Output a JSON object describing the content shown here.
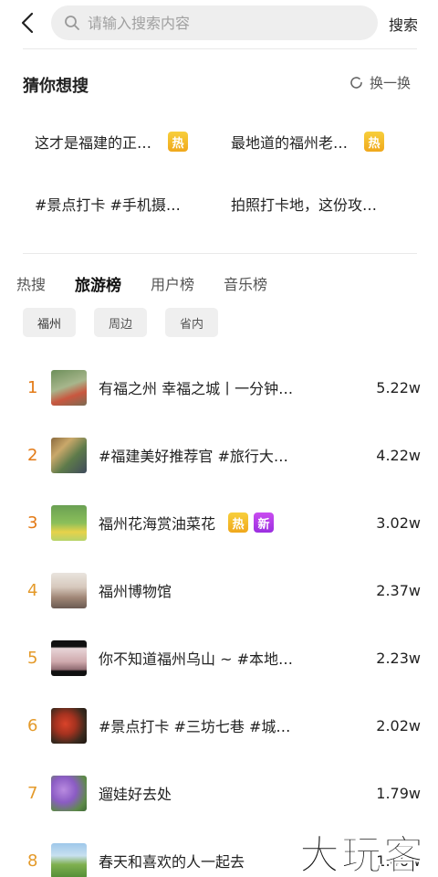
{
  "header": {
    "search_placeholder": "请输入搜索内容",
    "search_button": "搜索"
  },
  "guess": {
    "title": "猜你想搜",
    "refresh_label": "换一换",
    "items": [
      {
        "text": "这才是福建的正…",
        "badge": "热"
      },
      {
        "text": "最地道的福州老…",
        "badge": "热"
      },
      {
        "text": "#景点打卡 #手机摄…",
        "badge": ""
      },
      {
        "text": "拍照打卡地，这份攻…",
        "badge": ""
      }
    ]
  },
  "tabs": [
    {
      "label": "热搜",
      "active": false
    },
    {
      "label": "旅游榜",
      "active": true
    },
    {
      "label": "用户榜",
      "active": false
    },
    {
      "label": "音乐榜",
      "active": false
    }
  ],
  "chips": [
    {
      "label": "福州",
      "active": true
    },
    {
      "label": "周边",
      "active": false
    },
    {
      "label": "省内",
      "active": false
    }
  ],
  "ranking": [
    {
      "rank": "1",
      "title": "有福之州 幸福之城丨一分钟…",
      "count": "5.22w",
      "badges": []
    },
    {
      "rank": "2",
      "title": "#福建美好推荐官 #旅行大…",
      "count": "4.22w",
      "badges": []
    },
    {
      "rank": "3",
      "title": "福州花海赏油菜花",
      "count": "3.02w",
      "badges": [
        "热",
        "新"
      ]
    },
    {
      "rank": "4",
      "title": "福州博物馆",
      "count": "2.37w",
      "badges": []
    },
    {
      "rank": "5",
      "title": "你不知道福州乌山 ~ #本地…",
      "count": "2.23w",
      "badges": []
    },
    {
      "rank": "6",
      "title": "#景点打卡 #三坊七巷 #城…",
      "count": "2.02w",
      "badges": []
    },
    {
      "rank": "7",
      "title": "遛娃好去处",
      "count": "1.79w",
      "badges": []
    },
    {
      "rank": "8",
      "title": "春天和喜欢的人一起去",
      "count": "1.46w",
      "badges": []
    }
  ],
  "watermark": "大玩客",
  "colors": {
    "rank_accent": "#e49a2a",
    "hot_badge": "#f0b42a",
    "new_badge": "#b33ee8"
  }
}
